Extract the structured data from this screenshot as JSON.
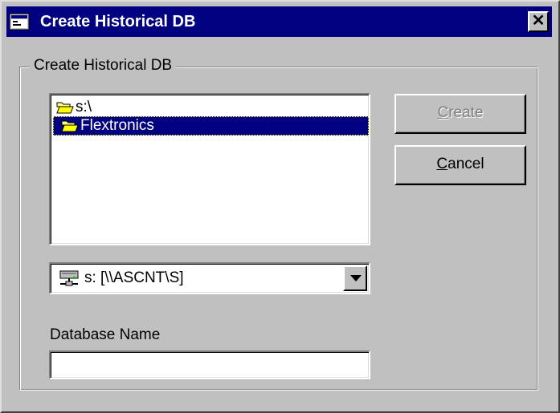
{
  "window": {
    "title": "Create Historical DB",
    "close_glyph": "✕"
  },
  "group": {
    "label": "Create Historical DB"
  },
  "folder_tree": {
    "items": [
      {
        "label": "s:\\",
        "icon": "open-folder-icon",
        "selected": false
      },
      {
        "label": "Flextronics",
        "icon": "open-folder-icon",
        "selected": true
      }
    ]
  },
  "drive_select": {
    "value": "s: [\\\\ASCNT\\S]",
    "icon": "network-drive-icon"
  },
  "database_name": {
    "label": "Database Name",
    "value": ""
  },
  "buttons": {
    "create": {
      "mnemonic": "C",
      "rest": "reate",
      "enabled": false
    },
    "cancel": {
      "mnemonic": "C",
      "rest": "ancel",
      "enabled": true
    }
  },
  "colors": {
    "titlebar": "#000080",
    "face": "#c0c0c0",
    "selection": "#000080"
  }
}
